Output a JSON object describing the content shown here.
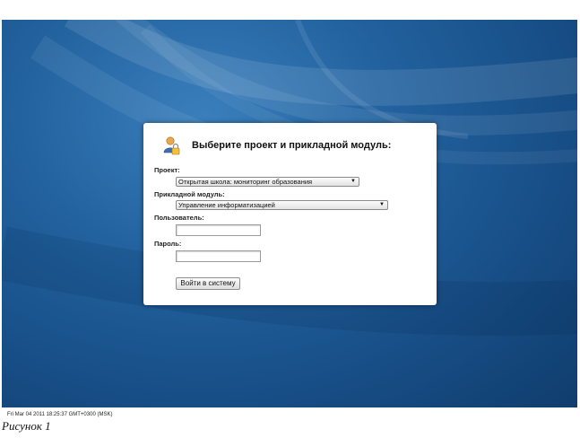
{
  "dialog": {
    "title": "Выберите проект и прикладной модуль:",
    "icon": "user-lock-icon",
    "project_label": "Проект:",
    "project_value": "Открытая школа: мониторинг образования",
    "module_label": "Прикладной модуль:",
    "module_value": "Управление информатизацией",
    "user_label": "Пользователь:",
    "user_value": "",
    "password_label": "Пароль:",
    "password_value": "",
    "login_button": "Войти в систему"
  },
  "footer": {
    "timestamp": "Fri Mar 04 2011 18:25:37 GMT+0300 (MSK)",
    "caption": "Рисунок 1"
  },
  "colors": {
    "background": "#1c5a96",
    "dialog": "#ffffff"
  }
}
